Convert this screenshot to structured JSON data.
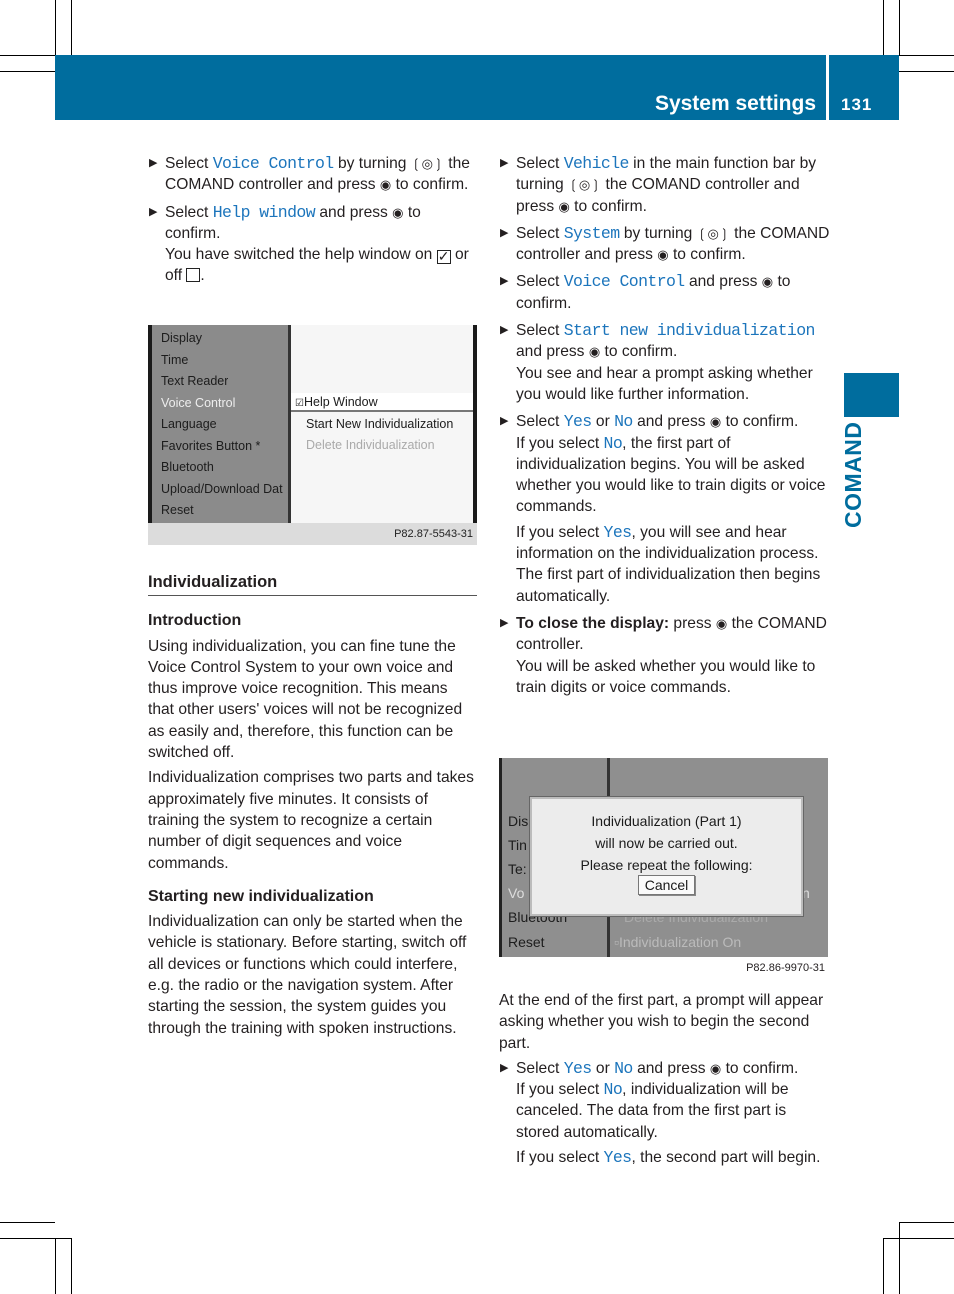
{
  "header": {
    "title": "System settings",
    "page_number": "131"
  },
  "side_tab": "COMAND",
  "colors": {
    "brand": "#006d9e",
    "link": "#1c75bc"
  },
  "left_column": [
    {
      "paras": [
        [
          {
            "t": "Select "
          },
          {
            "t": "Voice Control",
            "s": "code"
          },
          {
            "t": " by turning "
          },
          {
            "i": "turn"
          },
          {
            "t": " the COMAND controller and press "
          },
          {
            "i": "press"
          },
          {
            "t": " to confirm."
          }
        ]
      ],
      "bullet": true
    },
    {
      "paras": [
        [
          {
            "t": "Select "
          },
          {
            "t": "Help window",
            "s": "code"
          },
          {
            "t": " and press "
          },
          {
            "i": "press"
          },
          {
            "t": " to confirm."
          },
          {
            "br": 1
          },
          {
            "t": "You have switched the help window on "
          },
          {
            "i": "on"
          },
          {
            "t": " or off "
          },
          {
            "i": "off"
          },
          {
            "t": "."
          }
        ]
      ],
      "bullet": true
    }
  ],
  "screenshot1": {
    "menu": [
      "Display",
      "Time",
      "Text Reader",
      "Voice Control",
      "Language",
      "Favorites Button *",
      "Bluetooth",
      "Upload/Download Dat",
      "Reset"
    ],
    "selected_menu": "Voice Control",
    "submenu": [
      {
        "label": "Help Window",
        "checked": true
      },
      {
        "label": "Start New Individualization"
      },
      {
        "label": "Delete Individualization",
        "disabled": true
      }
    ],
    "caption": "P82.87-5543-31"
  },
  "section": {
    "title": "Individualization",
    "intro_heading": "Introduction",
    "intro_paras": [
      "Using individualization, you can fine tune the Voice Control System to your own voice and thus improve voice recognition. This means that other users' voices will not be recognized as easily and, therefore, this function can be switched off.",
      "Individualization comprises two parts and takes approximately five minutes. It consists of training the system to recognize a certain number of digit sequences and voice commands."
    ],
    "start_heading": "Starting new individualization",
    "start_para": "Individualization can only be started when the vehicle is stationary. Before starting, switch off all devices or functions which could interfere, e.g. the radio or the navigation system. After starting the session, the system guides you through the training with spoken instructions."
  },
  "right_column_top": [
    {
      "bullet": true,
      "paras": [
        [
          {
            "t": "Select "
          },
          {
            "t": "Vehicle",
            "s": "code"
          },
          {
            "t": " in the main function bar by turning "
          },
          {
            "i": "turn"
          },
          {
            "t": " the COMAND controller and press "
          },
          {
            "i": "press"
          },
          {
            "t": " to confirm."
          }
        ]
      ]
    },
    {
      "bullet": true,
      "paras": [
        [
          {
            "t": "Select "
          },
          {
            "t": "System",
            "s": "code"
          },
          {
            "t": " by turning "
          },
          {
            "i": "turn"
          },
          {
            "t": " the COMAND controller and press "
          },
          {
            "i": "press"
          },
          {
            "t": " to confirm."
          }
        ]
      ]
    },
    {
      "bullet": true,
      "paras": [
        [
          {
            "t": "Select "
          },
          {
            "t": "Voice Control",
            "s": "code"
          },
          {
            "t": " and press "
          },
          {
            "i": "press"
          },
          {
            "t": " to confirm."
          }
        ]
      ]
    },
    {
      "bullet": true,
      "paras": [
        [
          {
            "t": "Select "
          },
          {
            "t": "Start new individualization",
            "s": "code"
          },
          {
            "t": " and press "
          },
          {
            "i": "press"
          },
          {
            "t": " to confirm."
          },
          {
            "br": 1
          },
          {
            "t": "You see and hear a prompt asking whether you would like further information."
          }
        ]
      ]
    },
    {
      "bullet": true,
      "paras": [
        [
          {
            "t": "Select "
          },
          {
            "t": "Yes",
            "s": "code"
          },
          {
            "t": " or "
          },
          {
            "t": "No",
            "s": "code"
          },
          {
            "t": " and press "
          },
          {
            "i": "press"
          },
          {
            "t": " to confirm."
          },
          {
            "br": 1
          },
          {
            "t": "If you select "
          },
          {
            "t": "No",
            "s": "code"
          },
          {
            "t": ", the first part of individualization begins. You will be asked whether you would like to train digits or voice commands."
          }
        ],
        [
          {
            "t": "If you select "
          },
          {
            "t": "Yes",
            "s": "code"
          },
          {
            "t": ", you will see and hear information on the individualization process. The first part of individualization then begins automatically."
          }
        ]
      ]
    },
    {
      "bullet": true,
      "paras": [
        [
          {
            "t": "To close the display:",
            "s": "bold"
          },
          {
            "t": " press "
          },
          {
            "i": "press"
          },
          {
            "t": " the COMAND controller."
          },
          {
            "br": 1
          },
          {
            "t": "You will be asked whether you would like to train digits or voice commands."
          }
        ]
      ]
    }
  ],
  "screenshot2": {
    "menu_partial": [
      "Dis",
      "Tin",
      "Te:",
      "Vo",
      "Bluetooth",
      "Reset"
    ],
    "submenu_partial": [
      "n",
      "Delete Individualization",
      "Individualization On"
    ],
    "dialog_lines": [
      "Individualization (Part 1)",
      "will now be carried out.",
      "Please repeat the following:"
    ],
    "cancel_label": "Cancel",
    "caption": "P82.86-9970-31"
  },
  "right_column_bottom": [
    {
      "bullet": false,
      "paras": [
        [
          {
            "t": "At the end of the first part, a prompt will appear asking whether you wish to begin the second part."
          }
        ]
      ]
    },
    {
      "bullet": true,
      "paras": [
        [
          {
            "t": "Select "
          },
          {
            "t": "Yes",
            "s": "code"
          },
          {
            "t": " or "
          },
          {
            "t": "No",
            "s": "code"
          },
          {
            "t": " and press "
          },
          {
            "i": "press"
          },
          {
            "t": " to confirm."
          },
          {
            "br": 1
          },
          {
            "t": "If you select "
          },
          {
            "t": "No",
            "s": "code"
          },
          {
            "t": ", individualization will be canceled. The data from the first part is stored automatically."
          }
        ],
        [
          {
            "t": "If you select "
          },
          {
            "t": "Yes",
            "s": "code"
          },
          {
            "t": ", the second part will begin."
          }
        ]
      ]
    }
  ]
}
